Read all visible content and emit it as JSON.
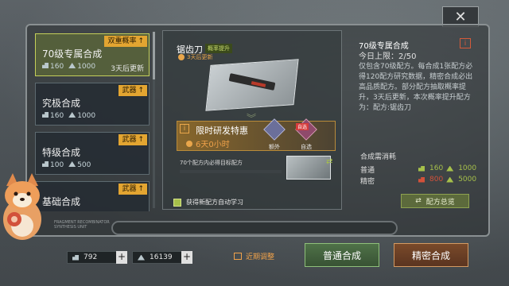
{
  "close_label": "✕",
  "recipes": [
    {
      "tag": "双重概率",
      "tag_icon": "arrow-up-icon",
      "name": "70级专属合成",
      "cost_a": "160",
      "cost_b": "1000",
      "refresh": "3天后更新",
      "selected": true
    },
    {
      "tag": "武器",
      "tag_icon": "arrow-up-icon",
      "name": "究极合成",
      "cost_a": "160",
      "cost_b": "1000",
      "refresh": "",
      "selected": false
    },
    {
      "tag": "武器",
      "tag_icon": "arrow-up-icon",
      "name": "特级合成",
      "cost_a": "100",
      "cost_b": "500",
      "refresh": "",
      "selected": false
    },
    {
      "tag": "武器",
      "tag_icon": "arrow-up-icon",
      "name": "基础合成",
      "cost_a": "",
      "cost_b": "",
      "refresh": "",
      "selected": false
    }
  ],
  "weapon": {
    "name": "锯齿刀",
    "rate_badge": "概率提升",
    "timer": "3天后更新"
  },
  "offer": {
    "warn": "i",
    "title": "限时研发特惠",
    "time_left": "6天0小时",
    "bonus_a_label": "额外",
    "bonus_b_label": "自选",
    "bonus_b_tag": "自选"
  },
  "guarantee": {
    "text": "70个配方内必得目标配方",
    "progress": 0.0
  },
  "auto_learn": {
    "label": "获得新配方自动学习",
    "checked": true
  },
  "info": {
    "title": "70级专属合成",
    "info_icon": "i",
    "daily_limit": "今日上限：2/50",
    "description": "仅包含70级配方。每合成1张配方必得120配方研究数据，精密合成必出高品质配方。部分配方抽取概率提升，3天后更新，本次概率提升配方为：配方:锯齿刀"
  },
  "costs": {
    "title": "合成需消耗",
    "rows": [
      {
        "label": "普通",
        "a": "160",
        "b": "1000",
        "a_ok": true
      },
      {
        "label": "精密",
        "a": "800",
        "b": "5000",
        "a_ok": false
      }
    ]
  },
  "overview_button": "配方总览",
  "bottom": {
    "res_a": "792",
    "res_b": "16139",
    "adjust_label": "近期调整",
    "normal_button": "普通合成",
    "precise_button": "精密合成",
    "watermark_line1": "FRAGMENT RECOMBINATOR",
    "watermark_line2": "SYNTHESIS UNIT"
  },
  "colors": {
    "accent_green": "#a6c04a",
    "accent_orange": "#e3a531",
    "warning_red": "#d2513a"
  }
}
